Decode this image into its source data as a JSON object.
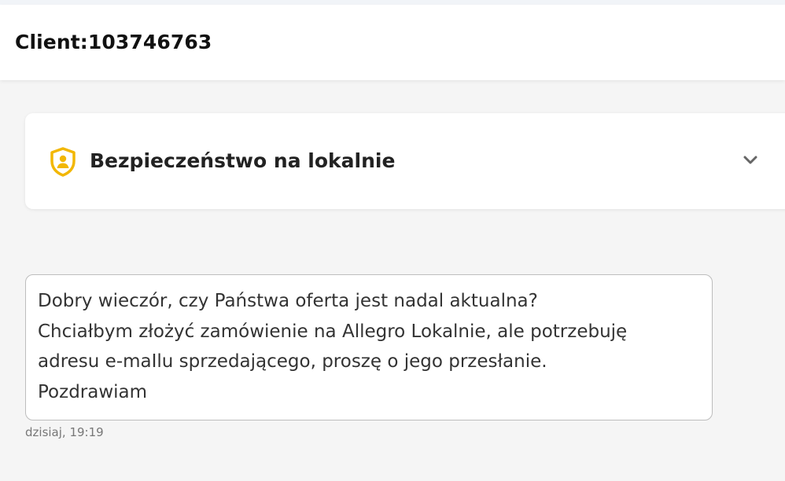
{
  "header": {
    "title": "Client:103746763"
  },
  "safety_card": {
    "icon": "shield-user-icon",
    "title": "Bezpieczeństwo na lokalnie",
    "chevron_icon": "chevron-down-icon",
    "icon_color": "#f2b705"
  },
  "message": {
    "lines": [
      "Dobry wieczór, czy Państwa oferta jest nadal aktualna?",
      "Chciałbym złożyć zamówienie na Allegro Lokalnie, ale potrzebuję",
      "adresu e-maIlu sprzedającego, proszę o jego przesłanie.",
      "Pozdrawiam"
    ],
    "timestamp": "dzisiaj, 19:19"
  }
}
